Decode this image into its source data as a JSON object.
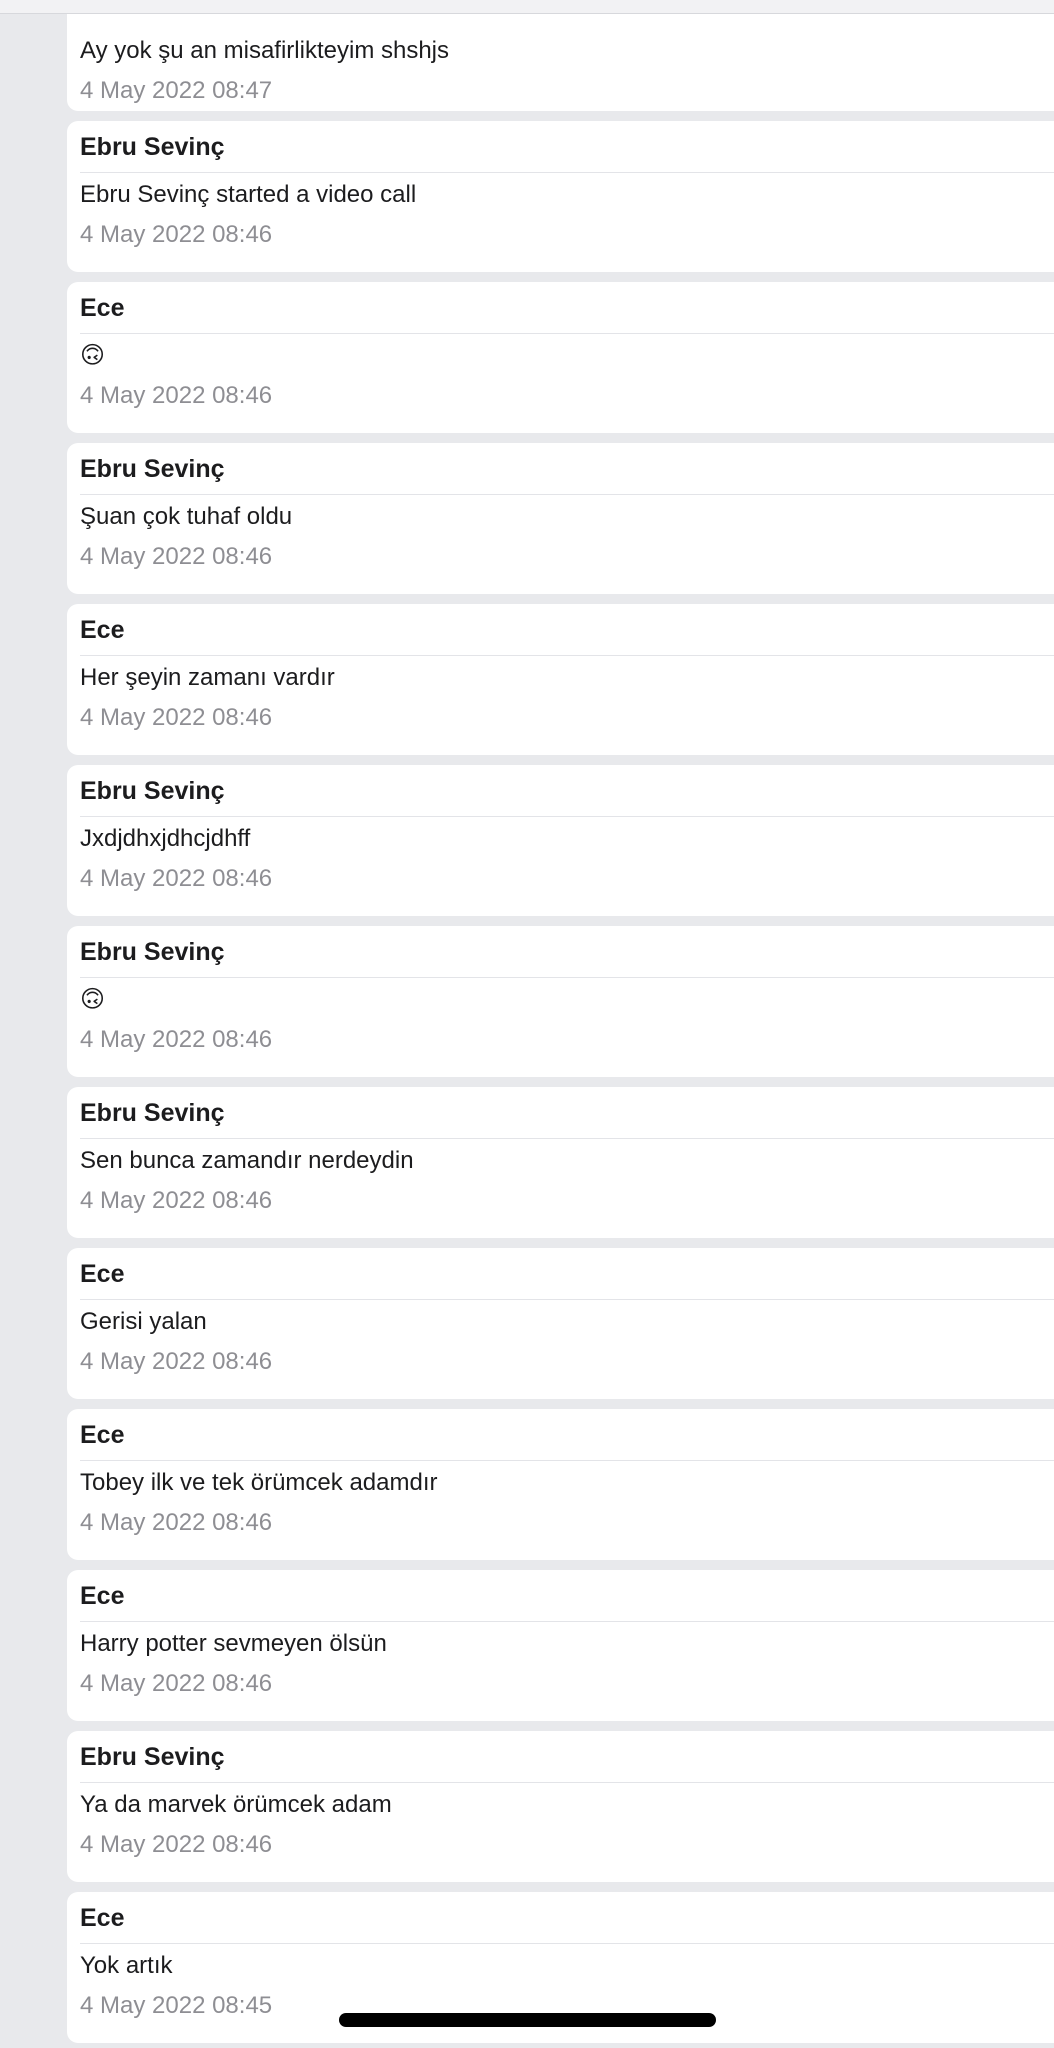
{
  "messages": [
    {
      "sender": "",
      "text": "Ay yok şu an misafirlikteyim shshjs",
      "time": "4 May 2022 08:47"
    },
    {
      "sender": "Ebru Sevinç",
      "text": "Ebru Sevinç started a video call",
      "time": "4 May 2022 08:46"
    },
    {
      "sender": "Ece",
      "text": "🙃",
      "time": "4 May 2022 08:46"
    },
    {
      "sender": "Ebru Sevinç",
      "text": "Şuan çok tuhaf oldu",
      "time": "4 May 2022 08:46"
    },
    {
      "sender": "Ece",
      "text": "Her şeyin zamanı vardır",
      "time": "4 May 2022 08:46"
    },
    {
      "sender": "Ebru Sevinç",
      "text": "Jxdjdhxjdhcjdhff",
      "time": "4 May 2022 08:46"
    },
    {
      "sender": "Ebru Sevinç",
      "text": "🙃",
      "time": "4 May 2022 08:46"
    },
    {
      "sender": "Ebru Sevinç",
      "text": "Sen bunca zamandır nerdeydin",
      "time": "4 May 2022 08:46"
    },
    {
      "sender": "Ece",
      "text": "Gerisi yalan",
      "time": "4 May 2022 08:46"
    },
    {
      "sender": "Ece",
      "text": "Tobey ilk ve tek örümcek adamdır",
      "time": "4 May 2022 08:46"
    },
    {
      "sender": "Ece",
      "text": "Harry potter sevmeyen ölsün",
      "time": "4 May 2022 08:46"
    },
    {
      "sender": "Ebru Sevinç",
      "text": "Ya da marvek örümcek adam",
      "time": "4 May 2022 08:46"
    },
    {
      "sender": "Ece",
      "text": "Yok artık",
      "time": "4 May 2022 08:45"
    }
  ]
}
